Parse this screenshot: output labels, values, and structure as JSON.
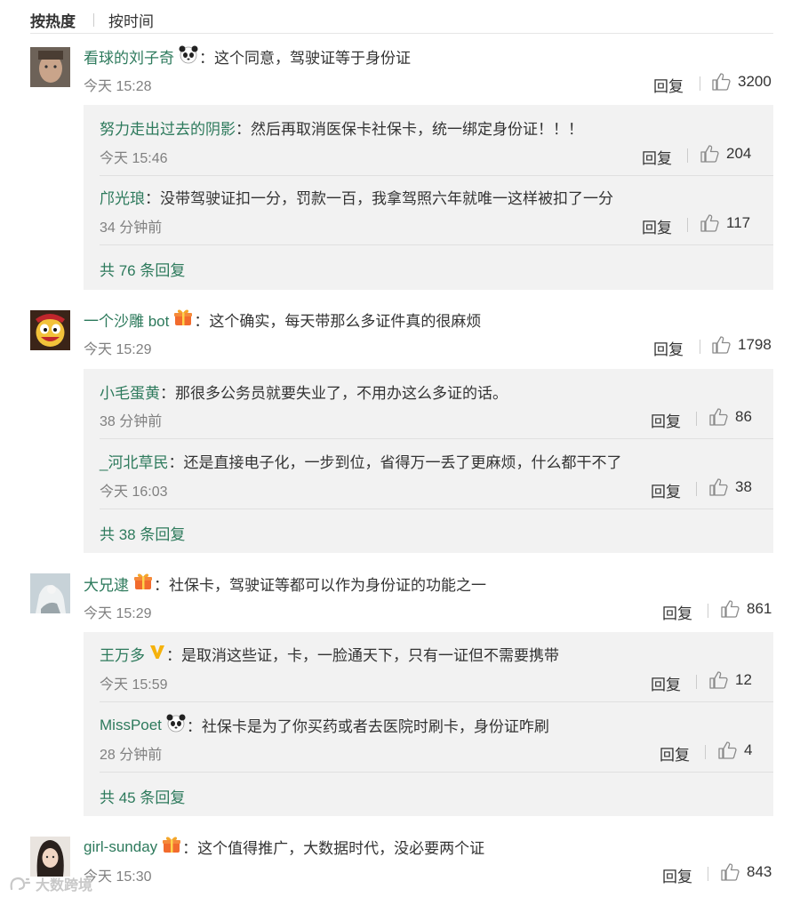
{
  "sort": {
    "hot": "按热度",
    "time": "按时间"
  },
  "colors": {
    "username": "#2d7a5c",
    "time": "#808080",
    "box": "#f2f2f2"
  },
  "comments": [
    {
      "user": "看球的刘子奇",
      "badge": "panda-icon",
      "text": "：这个同意，驾驶证等于身份证",
      "time": "今天 15:28",
      "reply": "回复",
      "likes": "3200",
      "replies": [
        {
          "user": "努力走出过去的阴影",
          "text": "：然后再取消医保卡社保卡，统一绑定身份证！！！",
          "time": "今天 15:46",
          "reply": "回复",
          "likes": "204"
        },
        {
          "user": "邝光琅",
          "text": "：没带驾驶证扣一分，罚款一百，我拿驾照六年就唯一这样被扣了一分",
          "time": "34 分钟前",
          "reply": "回复",
          "likes": "117"
        }
      ],
      "more": "共 76 条回复"
    },
    {
      "user": "一个沙雕 bot",
      "badge": "gift-icon",
      "text": "：这个确实，每天带那么多证件真的很麻烦",
      "time": "今天 15:29",
      "reply": "回复",
      "likes": "1798",
      "replies": [
        {
          "user": "小毛蛋黄",
          "text": "：那很多公务员就要失业了，不用办这么多证的话。",
          "time": "38 分钟前",
          "reply": "回复",
          "likes": "86"
        },
        {
          "user": "_河北草民",
          "text": "：还是直接电子化，一步到位，省得万一丢了更麻烦，什么都干不了",
          "time": "今天 16:03",
          "reply": "回复",
          "likes": "38"
        }
      ],
      "more": "共 38 条回复"
    },
    {
      "user": "大兄逮",
      "badge": "gift-icon",
      "text": "：社保卡，驾驶证等都可以作为身份证的功能之一",
      "time": "今天 15:29",
      "reply": "回复",
      "likes": "861",
      "replies": [
        {
          "user": "王万多",
          "badge": "v-icon",
          "text": "：是取消这些证，卡，一脸通天下，只有一证但不需要携带",
          "time": "今天 15:59",
          "reply": "回复",
          "likes": "12"
        },
        {
          "user": "MissPoet",
          "badge": "panda-icon",
          "text": "：社保卡是为了你买药或者去医院时刷卡，身份证咋刷",
          "time": "28 分钟前",
          "reply": "回复",
          "likes": "4"
        }
      ],
      "more": "共 45 条回复"
    },
    {
      "user": "girl-sunday",
      "badge": "gift-icon",
      "text": "：这个值得推广，大数据时代，没必要两个证",
      "time": "今天 15:30",
      "reply": "回复",
      "likes": "843"
    }
  ],
  "watermark": "大数跨境"
}
